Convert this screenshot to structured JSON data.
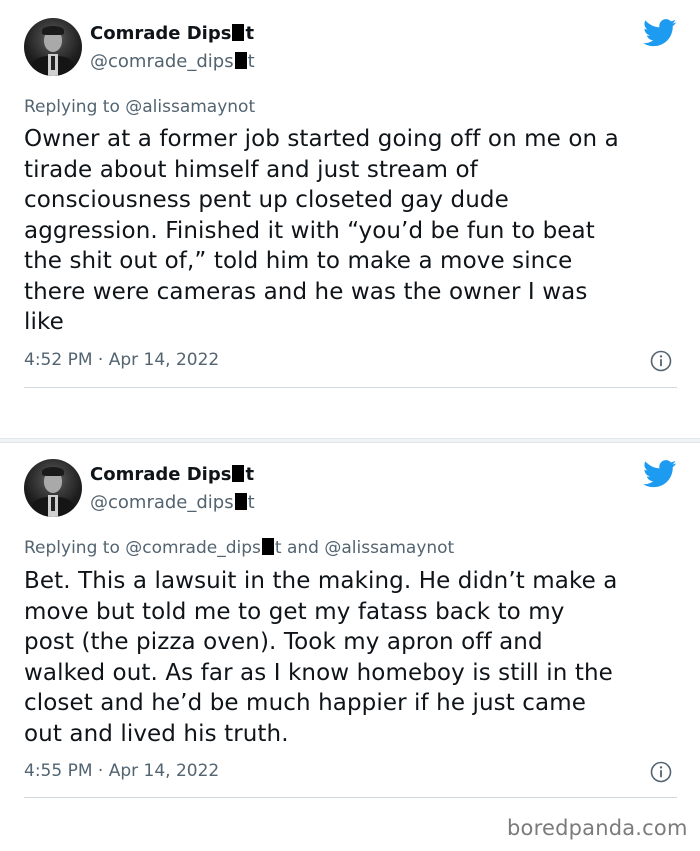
{
  "colors": {
    "twitter_blue": "#1d9bf0",
    "text_primary": "#0f1419",
    "text_secondary": "#536471",
    "divider": "#cfd9de"
  },
  "tweets": [
    {
      "author": {
        "name_start": "Comrade Dips",
        "name_end": "t",
        "handle_start": "@comrade_dips",
        "handle_end": "t"
      },
      "replying_label": "Replying to",
      "replying_to": "@alissamaynot",
      "lines": [
        "Owner at a former job started going off on me on a",
        "tirade about himself and just stream of",
        "consciousness pent up closeted gay dude",
        "aggression. Finished it with “you’d be fun to beat",
        "the shit out of,” told him to make a move since",
        "there were cameras and he was the owner I was",
        "like"
      ],
      "timestamp": "4:52 PM · Apr 14, 2022",
      "icons": {
        "brand": "twitter-bird-icon",
        "info": "info-icon"
      }
    },
    {
      "author": {
        "name_start": "Comrade Dips",
        "name_end": "t",
        "handle_start": "@comrade_dips",
        "handle_end": "t"
      },
      "replying_label": "Replying to",
      "replying_to_start": "@comrade_dips",
      "replying_to_end": "t and @alissamaynot",
      "lines": [
        "Bet. This a lawsuit in the making. He didn’t make a",
        "move but told me to get my fatass back to my",
        "post (the pizza oven). Took my apron off and",
        "walked out. As far as I know homeboy is still in the",
        "closet and he’d be much happier if he just came",
        "out and lived his truth."
      ],
      "timestamp": "4:55 PM · Apr 14, 2022",
      "icons": {
        "brand": "twitter-bird-icon",
        "info": "info-icon"
      }
    }
  ],
  "watermark": "boredpanda.com"
}
